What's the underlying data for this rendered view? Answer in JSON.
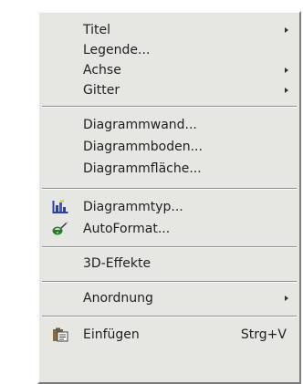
{
  "menu": {
    "items": [
      {
        "label": "Titel",
        "submenu": true
      },
      {
        "label": "Legende...",
        "submenu": false
      },
      {
        "label": "Achse",
        "submenu": true
      },
      {
        "label": "Gitter",
        "submenu": true
      },
      {
        "label": "Diagrammwand...",
        "submenu": false
      },
      {
        "label": "Diagrammboden...",
        "submenu": false
      },
      {
        "label": "Diagrammfläche...",
        "submenu": false
      },
      {
        "label": "Diagrammtyp...",
        "submenu": false,
        "icon": "chart-type-icon"
      },
      {
        "label": "AutoFormat...",
        "submenu": false,
        "icon": "autoformat-icon"
      },
      {
        "label": "3D-Effekte",
        "submenu": false
      },
      {
        "label": "Anordnung",
        "submenu": true
      },
      {
        "label": "Einfügen",
        "submenu": false,
        "icon": "paste-icon",
        "shortcut": "Strg+V"
      }
    ]
  },
  "colors": {
    "menu_background": "#e6e6e3",
    "text": "#1f1f1f",
    "separator_dark": "#8f8f8f",
    "separator_light": "#ffffff",
    "icon_blue": "#2a3fb0"
  }
}
